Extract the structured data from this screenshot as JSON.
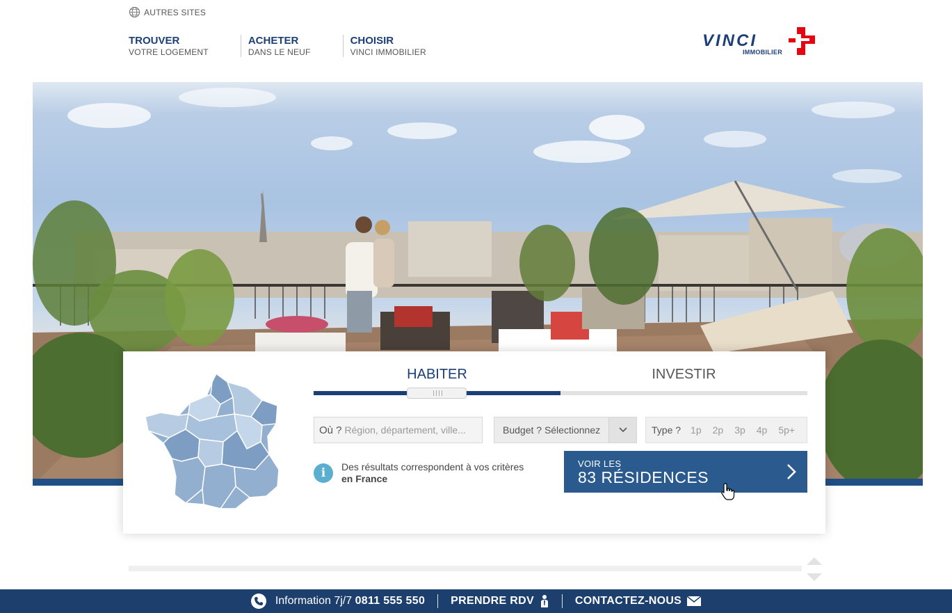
{
  "header": {
    "autres_sites": "AUTRES SITES",
    "nav": [
      {
        "main": "TROUVER",
        "sub": "VOTRE LOGEMENT"
      },
      {
        "main": "ACHETER",
        "sub": "DANS LE NEUF"
      },
      {
        "main": "CHOISIR",
        "sub": "VINCI IMMOBILIER"
      }
    ],
    "logo": {
      "word": "VINCI",
      "sub": "IMMOBILIER",
      "accent": "#e30613",
      "brand": "#1c3f77"
    }
  },
  "search": {
    "tabs": {
      "habiter": "HABITER",
      "investir": "INVESTIR"
    },
    "where_label": "Où ?",
    "where_placeholder": "Région, département, ville...",
    "budget_label": "Budget ? Sélectionnez",
    "type_label": "Type ?",
    "type_options": [
      "1p",
      "2p",
      "3p",
      "4p",
      "5p+"
    ],
    "info_line1": "Des résultats correspondent à vos critères",
    "info_line2": "en France",
    "cta_line1": "VOIR LES",
    "cta_line2": "83 RÉSIDENCES"
  },
  "footer": {
    "info_label": "Information 7j/7",
    "phone": "0811 555 550",
    "rdv": "PRENDRE RDV",
    "contact": "CONTACTEZ-NOUS"
  },
  "icons": {
    "globe": "globe-icon",
    "phone": "phone-icon",
    "rdv": "person-icon",
    "mail": "mail-icon",
    "info": "info-icon",
    "chevron": "chevron-right-icon"
  }
}
